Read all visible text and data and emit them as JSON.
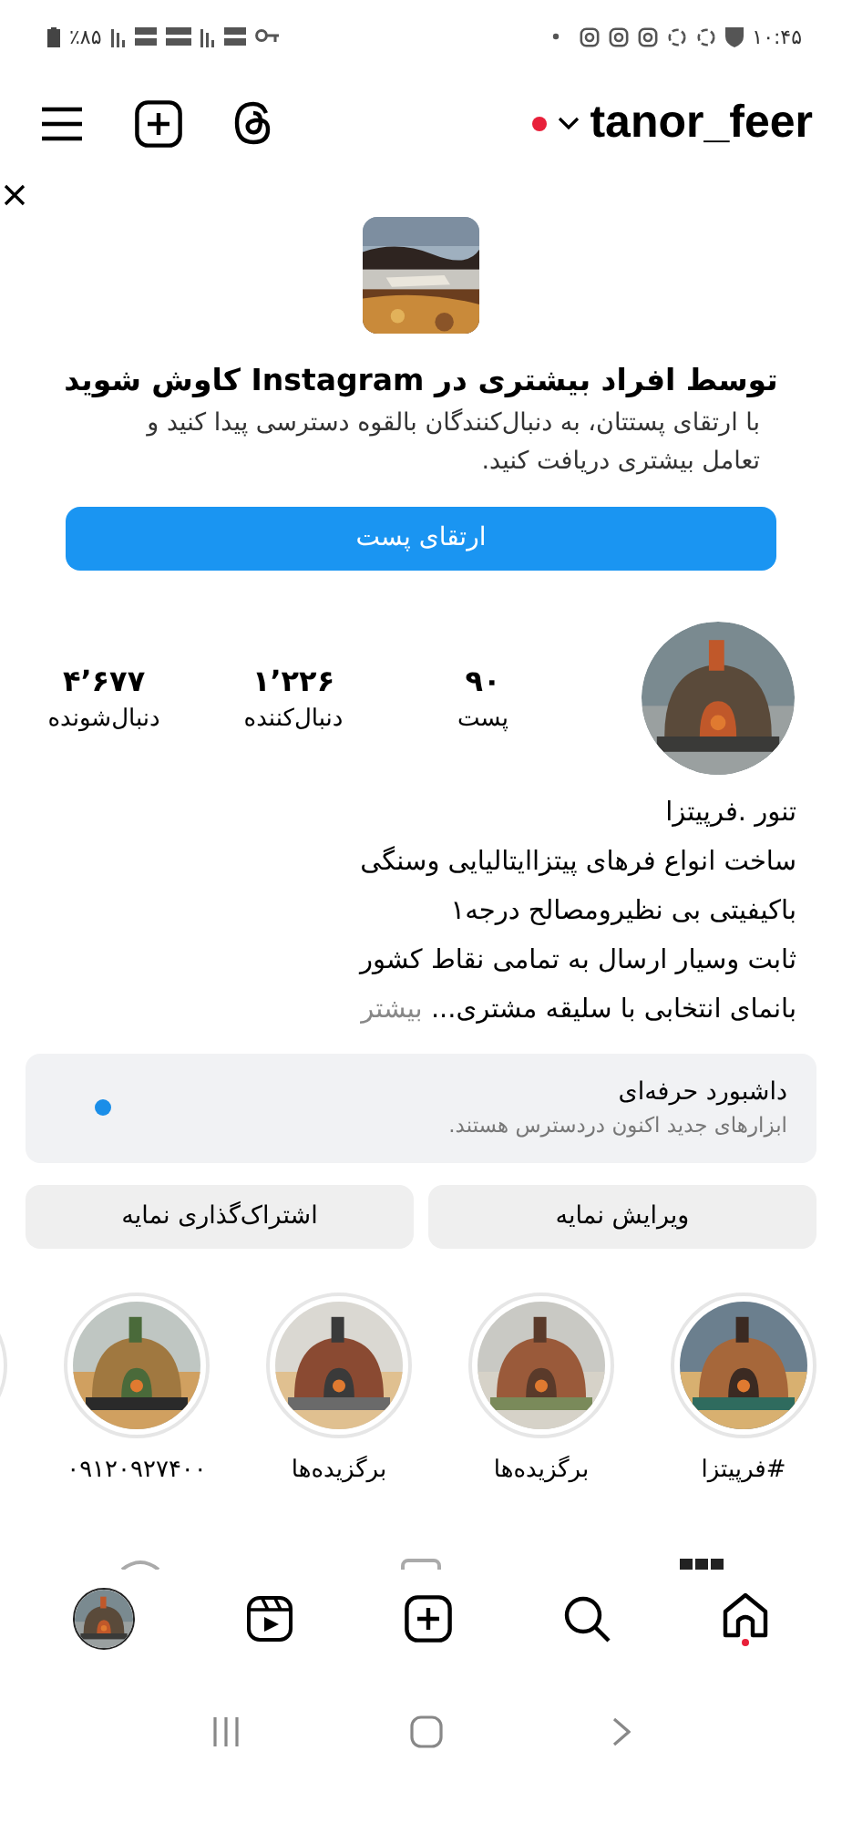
{
  "status_bar": {
    "battery": "٪۸۵",
    "time": "۱۰:۴۵"
  },
  "header": {
    "username": "tanor_feer"
  },
  "promo": {
    "title": "توسط افراد بیشتری در **Instagram** کاوش شوید",
    "text": "با ارتقای پستتان، به دنبال‌کنندگان بالقوه دسترسی پیدا کنید و تعامل بیشتری دریافت کنید.",
    "button": "ارتقای پست"
  },
  "profile": {
    "stats": [
      {
        "value": "۹۰",
        "label": "پست"
      },
      {
        "value": "۱٬۲۲۶",
        "label": "دنبال‌کننده"
      },
      {
        "value": "۴٬۶۷۷",
        "label": "دنبال‌شونده"
      }
    ],
    "bio": [
      "تنور .فرپیتزا",
      "ساخت انواع فرهای  پیتزاایتالیایی وسنگی",
      "باکیفیتی بی نظیرومصالح درجه۱",
      "ثابت وسیار ارسال به تمامی نقاط کشور"
    ],
    "bio_last": "بانمای انتخابی با سلیقه مشتری...",
    "more": "بیشتر"
  },
  "dashboard": {
    "title": "داشبورد حرفه‌ای",
    "subtitle": "ابزارهای جدید اکنون دردسترس هستند.",
    "color": "#1a8ee8"
  },
  "buttons": [
    "ویرایش نمایه",
    "اشتراک‌گذاری نمایه"
  ],
  "highlights": [
    {
      "label": "#فرپیتزا"
    },
    {
      "label": "برگزیده‌ها"
    },
    {
      "label": "برگزیده‌ها"
    },
    {
      "label": "۰۹۱۲۰۹۲۷۴۰۰"
    }
  ]
}
